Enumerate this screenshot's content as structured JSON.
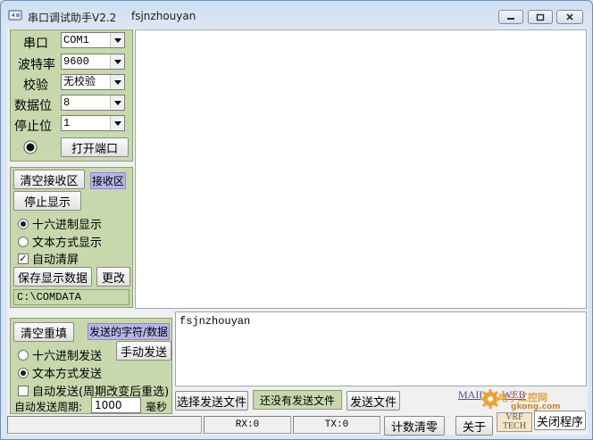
{
  "window": {
    "title": "串口调试助手V2.2",
    "subtitle": "fsjnzhouyan",
    "controls": [
      "minimize",
      "maximize",
      "close"
    ]
  },
  "port_settings": {
    "port_label": "串口",
    "port_value": "COM1",
    "baud_label": "波特率",
    "baud_value": "9600",
    "parity_label": "校验",
    "parity_value": "无校验",
    "databits_label": "数据位",
    "databits_value": "8",
    "stopbits_label": "停止位",
    "stopbits_value": "1",
    "open_button": "打开端口"
  },
  "receive": {
    "clear_button": "清空接收区",
    "area_label": "接收区",
    "stop_display_button": "停止显示",
    "hex_display": "十六进制显示",
    "text_display": "文本方式显示",
    "auto_clear": "自动清屏",
    "save_button": "保存显示数据",
    "change_button": "更改",
    "path": "C:\\COMDATA",
    "content": ""
  },
  "send": {
    "clear_button": "清空重填",
    "area_label": "发送的字符/数据",
    "hex_send": "十六进制发送",
    "text_send": "文本方式发送",
    "manual_button": "手动发送",
    "auto_send": "自动发送(周期改变后重选)",
    "period_label": "自动发送周期:",
    "period_value": "1000",
    "period_unit": "毫秒",
    "content": "fsjnzhouyan",
    "choose_file_button": "选择发送文件",
    "file_status": "还没有发送文件",
    "send_file_button": "发送文件"
  },
  "status": {
    "rx": "RX:0",
    "tx": "TX:0",
    "reset_counter_button": "计数清零",
    "about_button": "关于",
    "close_button": "关闭程序"
  },
  "links": {
    "mail": "MAIL",
    "web": "WEB"
  },
  "watermark": {
    "site_name": "电子工控网",
    "domain": "gkong.com",
    "logo_text": "VRF TECH"
  },
  "colors": {
    "panel_green": "#c8d8ad",
    "label_highlight": "#b8b4e8",
    "title_bar": "#cfdff0"
  }
}
